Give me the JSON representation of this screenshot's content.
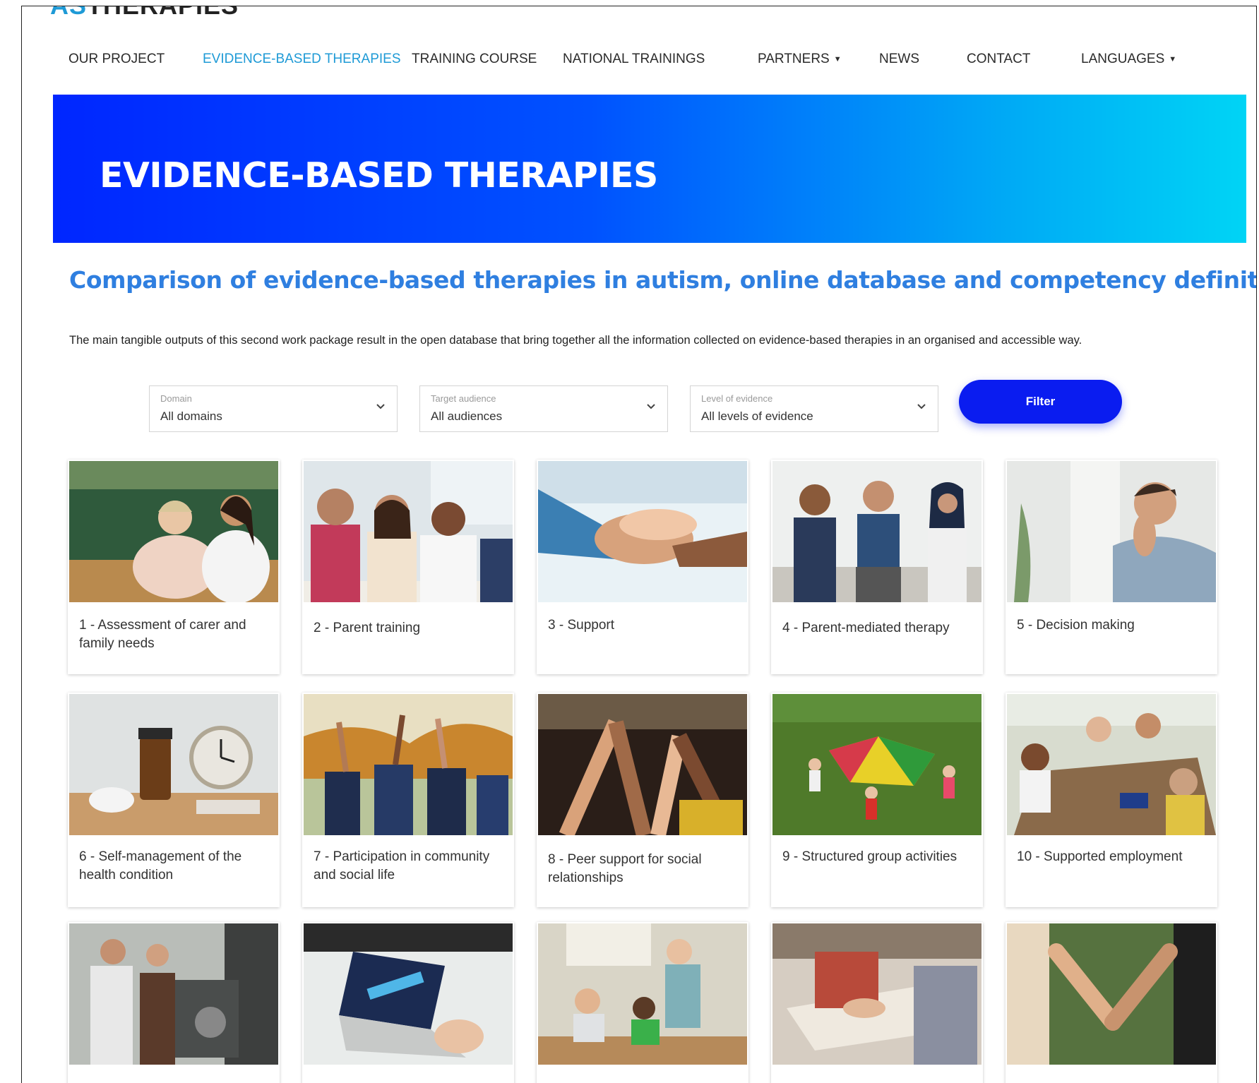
{
  "nav": {
    "items": [
      {
        "label": "OUR PROJECT",
        "active": false,
        "dropdown": false
      },
      {
        "label": "EVIDENCE-BASED THERAPIES",
        "active": true,
        "dropdown": false
      },
      {
        "label": "TRAINING COURSE",
        "active": false,
        "dropdown": false
      },
      {
        "label": "NATIONAL TRAININGS",
        "active": false,
        "dropdown": false
      },
      {
        "label": "PARTNERS",
        "active": false,
        "dropdown": true
      },
      {
        "label": "NEWS",
        "active": false,
        "dropdown": false
      },
      {
        "label": "CONTACT",
        "active": false,
        "dropdown": false
      },
      {
        "label": "LANGUAGES",
        "active": false,
        "dropdown": true
      }
    ]
  },
  "hero": {
    "title": "EVIDENCE-BASED THERAPIES"
  },
  "content": {
    "subtitle": "Comparison of evidence-based therapies in autism, online database and competency definition",
    "intro": "The main tangible outputs of this second work package result in the open database that bring together all the information collected on evidence-based therapies in an organised and accessible way."
  },
  "filters": {
    "domain": {
      "label": "Domain",
      "value": "All domains"
    },
    "audience": {
      "label": "Target audience",
      "value": "All audiences"
    },
    "evidence": {
      "label": "Level of evidence",
      "value": "All levels of evidence"
    },
    "button": "Filter"
  },
  "colors": {
    "accent": "#1e9ad6",
    "subtitle": "#2f7fe0",
    "button": "#0a1cf0",
    "hero_start": "#0026ff",
    "hero_end": "#00d4f5"
  },
  "cards": [
    {
      "title": "1 - Assessment of carer and family needs",
      "scene": "carer-nurse"
    },
    {
      "title": "2 - Parent training",
      "scene": "group-seated"
    },
    {
      "title": "3 - Support",
      "scene": "holding-hands"
    },
    {
      "title": "4 - Parent-mediated therapy",
      "scene": "circle-clapping"
    },
    {
      "title": "5 - Decision making",
      "scene": "man-thinking"
    },
    {
      "title": "6 - Self-management of the health condition",
      "scene": "pills-clock"
    },
    {
      "title": "7 - Participation in community and social life",
      "scene": "raised-hands"
    },
    {
      "title": "8 - Peer support for social relationships",
      "scene": "joined-hands"
    },
    {
      "title": "9 - Structured group activities",
      "scene": "parachute-game"
    },
    {
      "title": "10 - Supported employment",
      "scene": "meeting-table"
    },
    {
      "title": "",
      "scene": "workshop-machine"
    },
    {
      "title": "",
      "scene": "laptop-assessment"
    },
    {
      "title": "",
      "scene": "classroom"
    },
    {
      "title": "",
      "scene": "writing-desk"
    },
    {
      "title": "",
      "scene": "hands-walking"
    }
  ]
}
